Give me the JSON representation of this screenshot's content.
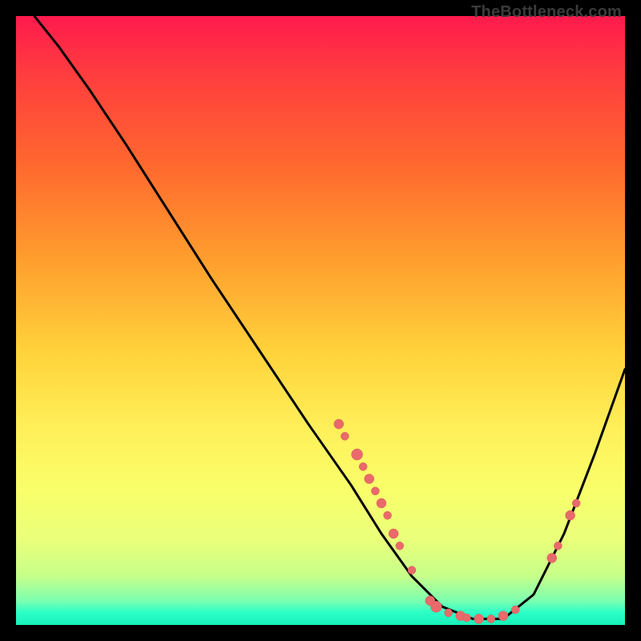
{
  "attribution": "TheBottleneck.com",
  "colors": {
    "curve_stroke": "#000000",
    "point_fill": "#e96a6a",
    "point_stroke": "#d55a5a",
    "gradient_top": "#ff1a4d",
    "gradient_bottom": "#18f0b8"
  },
  "chart_data": {
    "type": "line",
    "title": "",
    "xlabel": "",
    "ylabel": "",
    "xlim": [
      0,
      100
    ],
    "ylim": [
      0,
      100
    ],
    "grid": false,
    "legend": false,
    "curve": [
      {
        "x": 3,
        "y": 100
      },
      {
        "x": 7,
        "y": 95
      },
      {
        "x": 12,
        "y": 88
      },
      {
        "x": 18,
        "y": 79
      },
      {
        "x": 25,
        "y": 68
      },
      {
        "x": 32,
        "y": 57
      },
      {
        "x": 40,
        "y": 45
      },
      {
        "x": 48,
        "y": 33
      },
      {
        "x": 55,
        "y": 23
      },
      {
        "x": 60,
        "y": 15
      },
      {
        "x": 65,
        "y": 8
      },
      {
        "x": 70,
        "y": 3
      },
      {
        "x": 75,
        "y": 1
      },
      {
        "x": 80,
        "y": 1
      },
      {
        "x": 85,
        "y": 5
      },
      {
        "x": 90,
        "y": 15
      },
      {
        "x": 95,
        "y": 28
      },
      {
        "x": 100,
        "y": 42
      }
    ],
    "points": [
      {
        "x": 53,
        "y": 33,
        "r": 6
      },
      {
        "x": 54,
        "y": 31,
        "r": 5
      },
      {
        "x": 56,
        "y": 28,
        "r": 7
      },
      {
        "x": 57,
        "y": 26,
        "r": 5
      },
      {
        "x": 58,
        "y": 24,
        "r": 6
      },
      {
        "x": 59,
        "y": 22,
        "r": 5
      },
      {
        "x": 60,
        "y": 20,
        "r": 6
      },
      {
        "x": 61,
        "y": 18,
        "r": 5
      },
      {
        "x": 62,
        "y": 15,
        "r": 6
      },
      {
        "x": 63,
        "y": 13,
        "r": 5
      },
      {
        "x": 65,
        "y": 9,
        "r": 5
      },
      {
        "x": 68,
        "y": 4,
        "r": 6
      },
      {
        "x": 69,
        "y": 3,
        "r": 7
      },
      {
        "x": 71,
        "y": 2,
        "r": 5
      },
      {
        "x": 73,
        "y": 1.5,
        "r": 6
      },
      {
        "x": 74,
        "y": 1.2,
        "r": 5
      },
      {
        "x": 76,
        "y": 1,
        "r": 6
      },
      {
        "x": 78,
        "y": 1,
        "r": 5
      },
      {
        "x": 80,
        "y": 1.5,
        "r": 6
      },
      {
        "x": 82,
        "y": 2.5,
        "r": 5
      },
      {
        "x": 88,
        "y": 11,
        "r": 6
      },
      {
        "x": 89,
        "y": 13,
        "r": 5
      },
      {
        "x": 91,
        "y": 18,
        "r": 6
      },
      {
        "x": 92,
        "y": 20,
        "r": 5
      }
    ]
  }
}
